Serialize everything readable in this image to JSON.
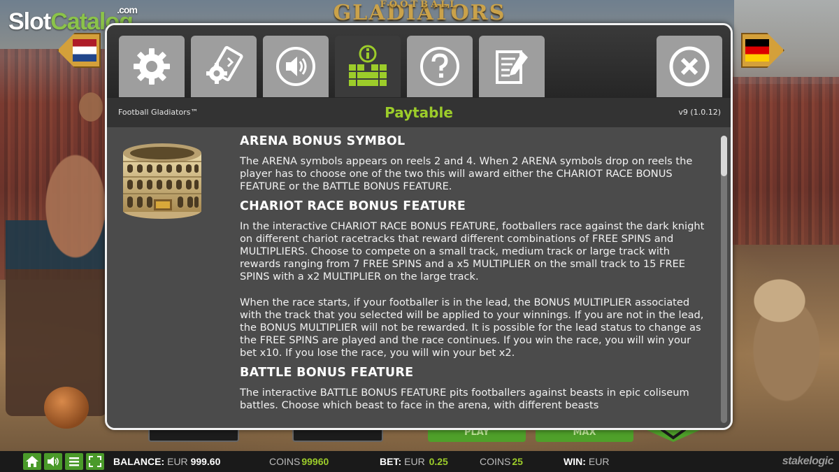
{
  "watermark": {
    "part1": "Slot",
    "part2": "Catalog",
    "suffix": ".com"
  },
  "game_logo": {
    "top": "FOOTBALL",
    "main": "GLADIATORS"
  },
  "flags": {
    "left": "netherlands-flag-icon",
    "right": "germany-flag-icon"
  },
  "tabs": [
    {
      "icon": "gear-icon",
      "active": false
    },
    {
      "icon": "autoplay-settings-icon",
      "active": false
    },
    {
      "icon": "speaker-icon",
      "active": false
    },
    {
      "icon": "paytable-icon",
      "active": true
    },
    {
      "icon": "help-icon",
      "active": false
    },
    {
      "icon": "notes-icon",
      "active": false
    }
  ],
  "close_icon": "close-icon",
  "subheader": {
    "game_name": "Football Gladiators™",
    "title": "Paytable",
    "version": "v9 (1.0.12)"
  },
  "content": {
    "arena_heading": "ARENA BONUS SYMBOL",
    "arena_text": "The ARENA symbols appears on reels 2 and 4. When 2 ARENA symbols drop on reels the player has to choose one of the two this will award either the CHARIOT RACE BONUS FEATURE or the BATTLE BONUS FEATURE.",
    "chariot_heading": "CHARIOT RACE BONUS FEATURE",
    "chariot_text_1": "In the interactive CHARIOT RACE BONUS FEATURE, footballers race against the dark knight on different chariot racetracks that reward different combinations of FREE SPINS and MULTIPLIERS. Choose to compete on a small track, medium track or large track with rewards ranging from 7 FREE SPINS and a x5 MULTIPLIER on the small track to 15 FREE SPINS with a x2 MULTIPLIER on the large track.",
    "chariot_text_2": "When the race starts, if your footballer is in the lead, the BONUS MULTIPLIER associated with the track that you selected will be applied to your winnings. If you are not in the lead, the BONUS MULTIPLIER will not be rewarded. It is possible for the lead status to change as the FREE SPINS are played and the race continues. If you win the race, you will win your bet x10. If you lose the race, you will win your bet x2.",
    "battle_heading": "BATTLE BONUS FEATURE",
    "battle_text": "The interactive BATTLE BONUS FEATURE pits footballers against beasts in epic coliseum battles. Choose which beast to face in the arena, with different beasts"
  },
  "controls_hidden": {
    "play": "PLAY",
    "max": "MAX"
  },
  "statusbar": {
    "buttons": [
      "home-icon",
      "sound-icon",
      "menu-icon",
      "fullscreen-icon"
    ],
    "balance_label": "BALANCE:",
    "balance_currency": "EUR",
    "balance_value": "999.60",
    "coins_label_1": "COINS",
    "coins_value_1": "99960",
    "bet_label": "BET:",
    "bet_currency": "EUR",
    "bet_value": "0.25",
    "coins_label_2": "COINS",
    "coins_value_2": "25",
    "win_label": "WIN:",
    "win_currency": "EUR",
    "brand": "stakelogic"
  },
  "colors": {
    "accent_green": "#9ccc2a",
    "tab_inactive": "#9e9e9e",
    "tab_active": "#3b3b3b",
    "content_bg": "#4b4b4b"
  }
}
